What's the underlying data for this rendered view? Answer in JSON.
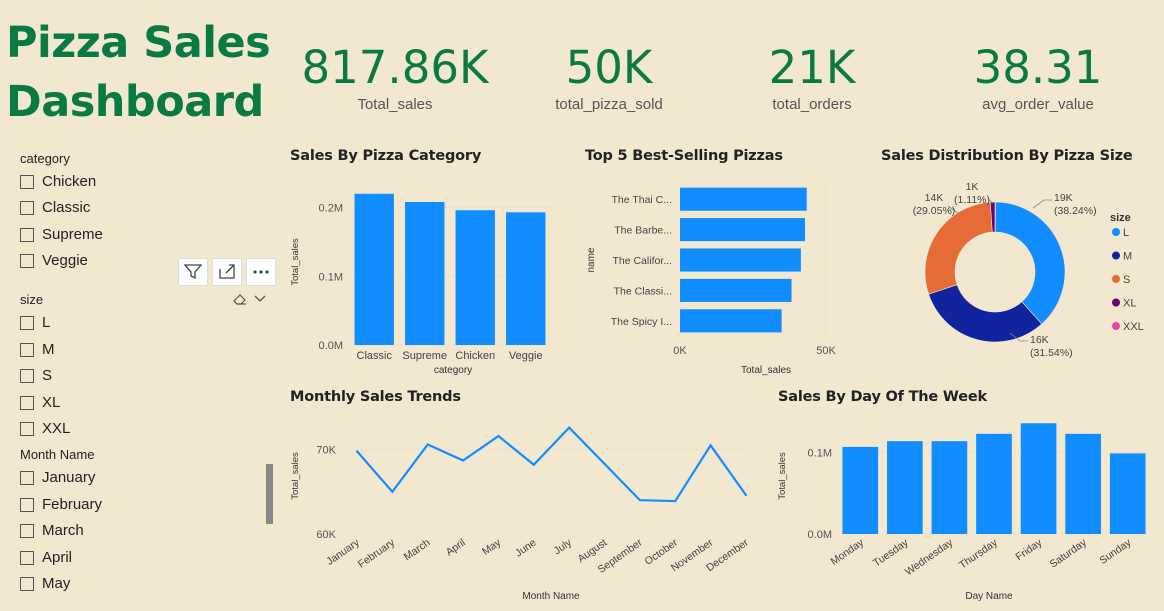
{
  "title": {
    "line1": "Pizza Sales",
    "line2": "Dashboard"
  },
  "kpis": [
    {
      "value": "817.86K",
      "label": "Total_sales"
    },
    {
      "value": "50K",
      "label": "total_pizza_sold"
    },
    {
      "value": "21K",
      "label": "total_orders"
    },
    {
      "value": "38.31",
      "label": "avg_order_value"
    }
  ],
  "slicers": {
    "category": {
      "header": "category",
      "items": [
        "Chicken",
        "Classic",
        "Supreme",
        "Veggie"
      ]
    },
    "size": {
      "header": "size",
      "items": [
        "L",
        "M",
        "S",
        "XL",
        "XXL"
      ]
    },
    "month": {
      "header": "Month Name",
      "items": [
        "January",
        "February",
        "March",
        "April",
        "May"
      ]
    }
  },
  "colors": {
    "accent": "#118dff",
    "title_green": "#0a7a43",
    "background": "#f2e8d0"
  },
  "icons": {
    "filter": "filter-icon",
    "focus": "focus-mode-icon",
    "more": "more-options-icon",
    "eraser": "clear-selections-icon",
    "chevron": "chevron-down-icon"
  },
  "chart_data": [
    {
      "id": "category",
      "type": "bar",
      "title": "Sales By Pizza Category",
      "xlabel": "category",
      "ylabel": "Total_sales",
      "categories": [
        "Classic",
        "Supreme",
        "Chicken",
        "Veggie"
      ],
      "values": [
        220000,
        208000,
        196000,
        193000
      ],
      "yticks": [
        {
          "v": 0,
          "t": "0.0M"
        },
        {
          "v": 100000,
          "t": "0.1M"
        },
        {
          "v": 200000,
          "t": "0.2M"
        }
      ],
      "ylim": [
        0,
        240000
      ]
    },
    {
      "id": "top5",
      "type": "bar",
      "orientation": "horizontal",
      "title": "Top 5 Best-Selling Pizzas",
      "xlabel": "Total_sales",
      "ylabel": "name",
      "categories": [
        "The Thai C...",
        "The Barbe...",
        "The Califor...",
        "The Classi...",
        "The Spicy I..."
      ],
      "values": [
        43400,
        42800,
        41400,
        38200,
        34800
      ],
      "xticks": [
        {
          "v": 0,
          "t": "0K"
        },
        {
          "v": 50000,
          "t": "50K"
        }
      ],
      "xlim": [
        0,
        50000
      ]
    },
    {
      "id": "size",
      "type": "pie",
      "title": "Sales Distribution By Pizza Size",
      "legend_title": "size",
      "slices": [
        {
          "name": "L",
          "value": 38.24,
          "label": "19K",
          "pct": "(38.24%)",
          "color": "#118dff"
        },
        {
          "name": "M",
          "value": 31.54,
          "label": "16K",
          "pct": "(31.54%)",
          "color": "#12239e"
        },
        {
          "name": "S",
          "value": 29.05,
          "label": "14K",
          "pct": "(29.05%)",
          "color": "#e66c37"
        },
        {
          "name": "XL",
          "value": 1.11,
          "label": "1K",
          "pct": "(1.11%)",
          "color": "#6b007b"
        },
        {
          "name": "XXL",
          "value": 0.06,
          "label": "",
          "pct": "",
          "color": "#e044a7"
        }
      ]
    },
    {
      "id": "monthly",
      "type": "line",
      "title": "Monthly Sales Trends",
      "xlabel": "Month Name",
      "ylabel": "Total_sales",
      "categories": [
        "January",
        "February",
        "March",
        "April",
        "May",
        "June",
        "July",
        "August",
        "September",
        "October",
        "November",
        "December"
      ],
      "values": [
        69800,
        65000,
        70600,
        68700,
        71600,
        68200,
        72600,
        68300,
        64000,
        63900,
        70500,
        64600
      ],
      "yticks": [
        {
          "v": 60000,
          "t": "60K"
        },
        {
          "v": 70000,
          "t": "70K"
        }
      ],
      "ylim": [
        60000,
        73500
      ]
    },
    {
      "id": "weekday",
      "type": "bar",
      "title": "Sales By Day Of The Week",
      "xlabel": "Day Name",
      "ylabel": "Total_sales",
      "categories": [
        "Monday",
        "Tuesday",
        "Wednesday",
        "Thursday",
        "Friday",
        "Saturday",
        "Sunday"
      ],
      "values": [
        107000,
        114000,
        114000,
        123000,
        136000,
        123000,
        99000
      ],
      "yticks": [
        {
          "v": 0,
          "t": "0.0M"
        },
        {
          "v": 100000,
          "t": "0.1M"
        }
      ],
      "ylim": [
        0,
        140000
      ]
    }
  ]
}
